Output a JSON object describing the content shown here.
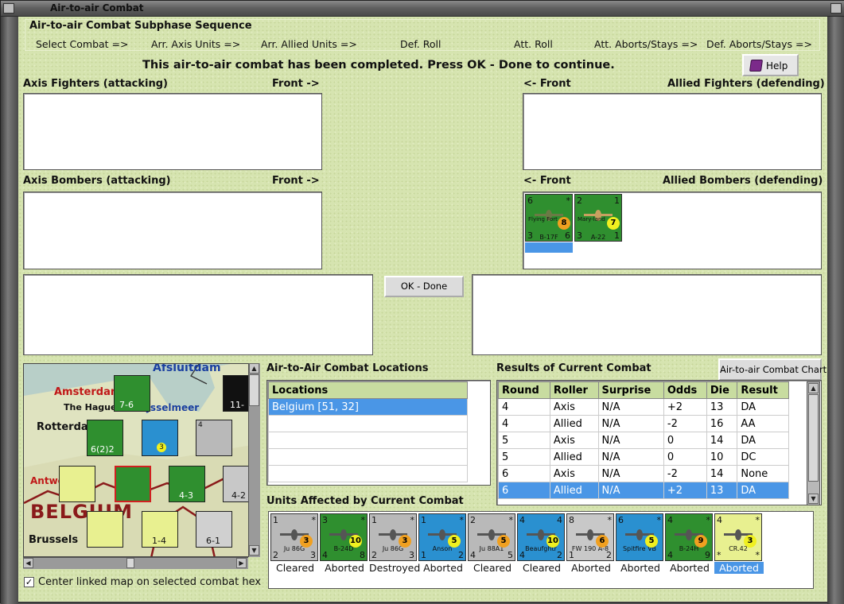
{
  "window": {
    "title": "Air-to-air Combat"
  },
  "sequence": {
    "title": "Air-to-air Combat Subphase Sequence",
    "steps": [
      "Select Combat =>",
      "Arr. Axis Units =>",
      "Arr. Allied Units =>",
      "Def. Roll",
      "Att. Roll",
      "Att. Aborts/Stays =>",
      "Def. Aborts/Stays =>"
    ]
  },
  "status_message": "This air-to-air combat has been completed.  Press OK - Done to continue.",
  "help_button": "Help",
  "labels": {
    "axis_fighters": "Axis Fighters (attacking)",
    "axis_fighters_front": "Front ->",
    "allied_fighters_front": "<- Front",
    "allied_fighters": "Allied Fighters (defending)",
    "axis_bombers": "Axis Bombers (attacking)",
    "axis_bombers_front": "Front ->",
    "allied_bombers_front": "<- Front",
    "allied_bombers": "Allied Bombers (defending)"
  },
  "allied_bombers_units": [
    {
      "name": "B-17F",
      "sub": "Flying Fort",
      "top_left": "6",
      "top_right": "*",
      "bottom_left": "3",
      "bottom_right": "6",
      "die": "8",
      "color": "#2f8f2f"
    },
    {
      "name": "A-22",
      "sub": "Mary-land",
      "top_left": "2",
      "top_right": "1",
      "bottom_left": "3",
      "bottom_right": "1",
      "die": "7",
      "color": "#2f8f2f"
    }
  ],
  "ok_button": "OK - Done",
  "map": {
    "labels": [
      "Afsluitdam",
      "Amsterdam",
      "The Hague",
      "IJsselmeer",
      "Rotterdam",
      "Antwerp",
      "BELGIUM",
      "Brussels"
    ],
    "counters": [
      {
        "value": "7-6"
      },
      {
        "value": "6(2)2"
      },
      {
        "value": "3"
      },
      {
        "value": "11-"
      },
      {
        "value": "4-3"
      },
      {
        "value": "4-2"
      },
      {
        "value": "4"
      },
      {
        "value": "1-4"
      },
      {
        "value": "6-1"
      }
    ],
    "center_checkbox_label": "Center linked map on selected combat hex",
    "center_checked": "✓"
  },
  "locations": {
    "title": "Air-to-Air Combat Locations",
    "header": "Locations",
    "rows": [
      "Belgium [51, 32]",
      "",
      "",
      "",
      "",
      ""
    ]
  },
  "results": {
    "title": "Results of Current Combat",
    "chart_button": "Air-to-air Combat Chart",
    "columns": [
      "Round",
      "Roller",
      "Surprise",
      "Odds",
      "Die",
      "Result"
    ],
    "rows": [
      [
        "4",
        "Axis",
        "N/A",
        "+2",
        "13",
        "DA"
      ],
      [
        "4",
        "Allied",
        "N/A",
        "-2",
        "16",
        "AA"
      ],
      [
        "5",
        "Axis",
        "N/A",
        "0",
        "14",
        "DA"
      ],
      [
        "5",
        "Allied",
        "N/A",
        "0",
        "10",
        "DC"
      ],
      [
        "6",
        "Axis",
        "N/A",
        "-2",
        "14",
        "None"
      ],
      [
        "6",
        "Allied",
        "N/A",
        "+2",
        "13",
        "DA"
      ]
    ],
    "selected_row": 5
  },
  "affected": {
    "title": "Units Affected by Current Combat",
    "units": [
      {
        "name": "Ju 86G",
        "status": "Cleared",
        "tl": "1",
        "tr": "*",
        "bl": "2",
        "br": "3",
        "die": "3",
        "color": "#b9b9b9"
      },
      {
        "name": "B-24D",
        "status": "Aborted",
        "tl": "3",
        "tr": "*",
        "bl": "4",
        "br": "8",
        "die": "10",
        "color": "#2f8f2f"
      },
      {
        "name": "Ju 86G",
        "status": "Destroyed",
        "tl": "1",
        "tr": "*",
        "bl": "2",
        "br": "3",
        "die": "3",
        "color": "#b9b9b9"
      },
      {
        "name": "Anson",
        "status": "Aborted",
        "tl": "1",
        "tr": "*",
        "bl": "1",
        "br": "2",
        "die": "5",
        "color": "#2a90d0"
      },
      {
        "name": "Ju 88A1",
        "status": "Cleared",
        "tl": "2",
        "tr": "*",
        "bl": "4",
        "br": "5",
        "die": "5",
        "color": "#b9b9b9"
      },
      {
        "name": "Beaufghtr",
        "status": "Cleared",
        "tl": "4",
        "tr": "4",
        "bl": "4",
        "br": "2",
        "die": "10",
        "color": "#2a90d0"
      },
      {
        "name": "FW 190 A-8",
        "status": "Aborted",
        "tl": "8",
        "tr": "*",
        "bl": "1",
        "br": "2",
        "die": "6",
        "color": "#c8c8c8"
      },
      {
        "name": "Spitfire VB",
        "status": "Aborted",
        "tl": "6",
        "tr": "*",
        "bl": "",
        "br": "",
        "die": "5",
        "color": "#2a90d0"
      },
      {
        "name": "B-24H",
        "status": "Aborted",
        "tl": "4",
        "tr": "*",
        "bl": "4",
        "br": "9",
        "die": "9",
        "color": "#2f8f2f"
      },
      {
        "name": "CR.42",
        "status": "Aborted",
        "tl": "4",
        "tr": "*",
        "bl": "*",
        "br": "*",
        "die": "3",
        "color": "#e8f090"
      }
    ],
    "selected_index": 9
  }
}
